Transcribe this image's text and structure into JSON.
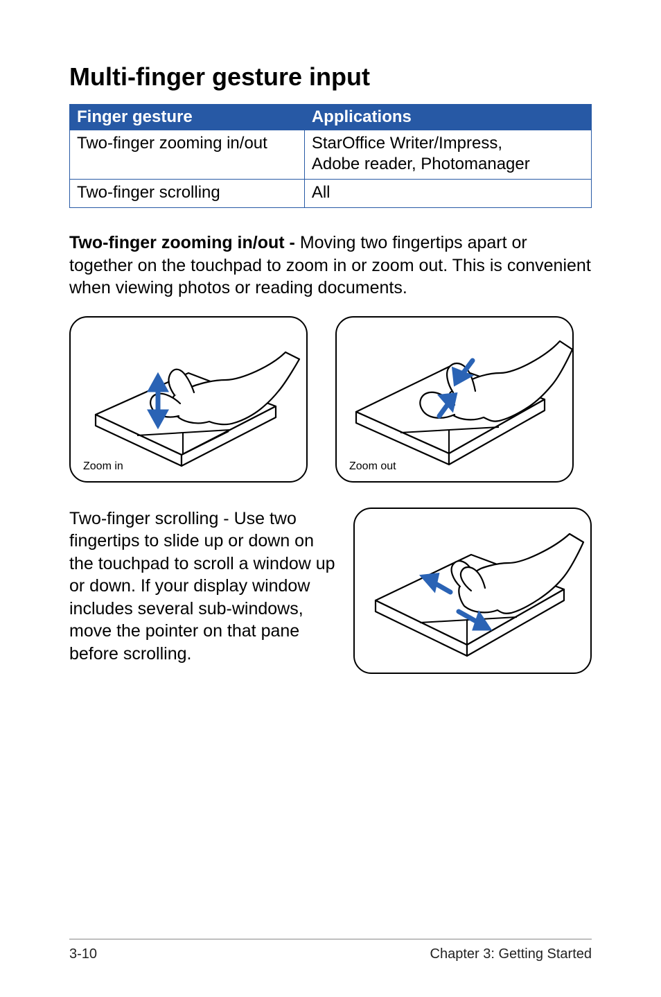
{
  "title": "Multi-finger gesture input",
  "table": {
    "headers": {
      "gesture": "Finger gesture",
      "apps": "Applications"
    },
    "rows": [
      {
        "gesture": "Two-finger zooming in/out",
        "apps": "StarOffice Writer/Impress,\nAdobe reader, Photomanager"
      },
      {
        "gesture": "Two-finger scrolling",
        "apps": "All"
      }
    ]
  },
  "zoom": {
    "lead": "Two-finger zooming in/out - ",
    "body": "Moving two fingertips apart or together on the touchpad to zoom in or zoom out. This is convenient when viewing photos or reading documents.",
    "fig_in_caption": "Zoom in",
    "fig_out_caption": "Zoom out"
  },
  "scroll": {
    "lead": "Two-finger scrolling - ",
    "body": "Use two fingertips to slide up or down on the touchpad to scroll a window up or down. If your display window includes several sub-windows, move the pointer on that pane before scrolling."
  },
  "footer": {
    "left": "3-10",
    "right": "Chapter 3: Getting Started"
  }
}
